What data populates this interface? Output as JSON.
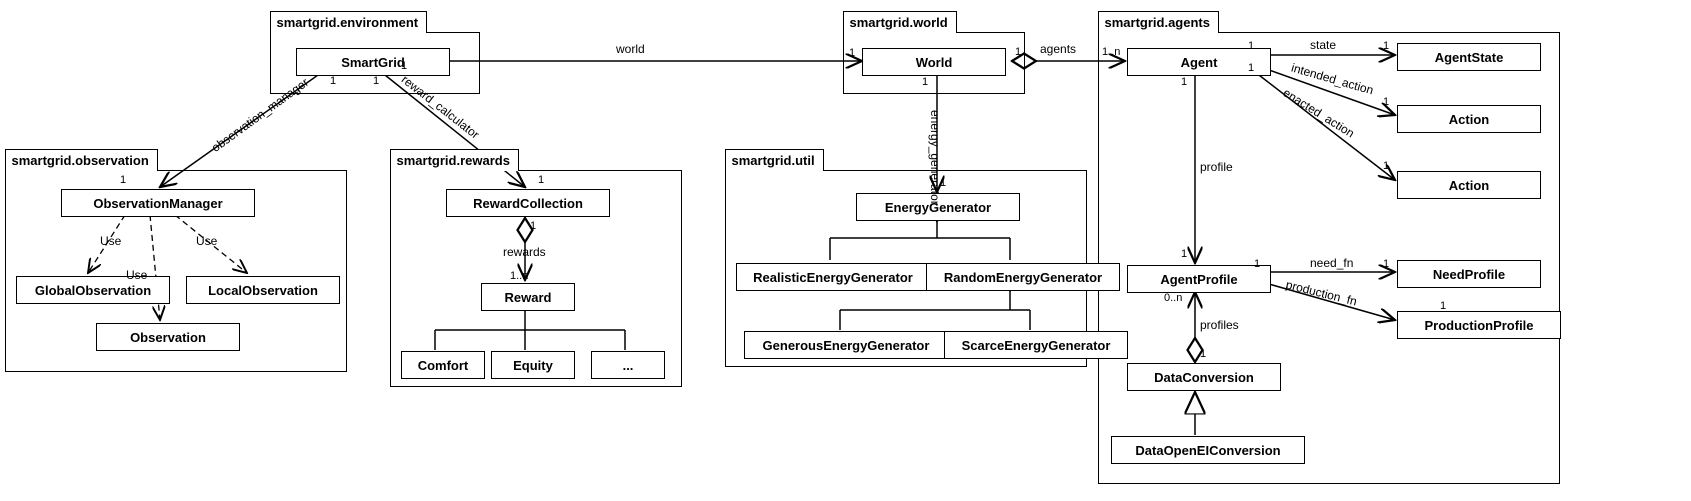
{
  "packages": {
    "environment": {
      "label": "smartgrid.environment"
    },
    "world": {
      "label": "smartgrid.world"
    },
    "agents": {
      "label": "smartgrid.agents"
    },
    "observation": {
      "label": "smartgrid.observation"
    },
    "rewards": {
      "label": "smartgrid.rewards"
    },
    "util": {
      "label": "smartgrid.util"
    }
  },
  "classes": {
    "SmartGrid": "SmartGrid",
    "World": "World",
    "Agent": "Agent",
    "AgentState": "AgentState",
    "Action1": "Action",
    "Action2": "Action",
    "AgentProfile": "AgentProfile",
    "NeedProfile": "NeedProfile",
    "ProductionProfile": "ProductionProfile",
    "DataConversion": "DataConversion",
    "DataOpenEIConversion": "DataOpenEIConversion",
    "ObservationManager": "ObservationManager",
    "GlobalObservation": "GlobalObservation",
    "LocalObservation": "LocalObservation",
    "Observation": "Observation",
    "RewardCollection": "RewardCollection",
    "Reward": "Reward",
    "Comfort": "Comfort",
    "Equity": "Equity",
    "Ellipsis": "...",
    "EnergyGenerator": "EnergyGenerator",
    "RealisticEnergyGenerator": "RealisticEnergyGenerator",
    "RandomEnergyGenerator": "RandomEnergyGenerator",
    "GenerousEnergyGenerator": "GenerousEnergyGenerator",
    "ScarceEnergyGenerator": "ScarceEnergyGenerator"
  },
  "labels": {
    "world_rel": "world",
    "agents_rel": "agents",
    "state_rel": "state",
    "intended_action": "intended_action",
    "enacted_action": "enacted_action",
    "profile": "profile",
    "need_fn": "need_fn",
    "production_fn": "production_fn",
    "profiles": "profiles",
    "energy_generator": "energy_generator",
    "observation_manager": "observation_manager",
    "reward_calculator": "reward_calculator",
    "Use": "Use",
    "rewards": "rewards"
  },
  "mults": {
    "one": "1",
    "one_n": "1..n",
    "zero_n": "0..n"
  },
  "chart_data": {
    "type": "uml_class_diagram",
    "packages": [
      {
        "name": "smartgrid.environment",
        "classes": [
          "SmartGrid"
        ]
      },
      {
        "name": "smartgrid.world",
        "classes": [
          "World"
        ]
      },
      {
        "name": "smartgrid.agents",
        "classes": [
          "Agent",
          "AgentState",
          "Action",
          "Action",
          "AgentProfile",
          "NeedProfile",
          "ProductionProfile",
          "DataConversion",
          "DataOpenEIConversion"
        ]
      },
      {
        "name": "smartgrid.observation",
        "classes": [
          "ObservationManager",
          "GlobalObservation",
          "LocalObservation",
          "Observation"
        ]
      },
      {
        "name": "smartgrid.rewards",
        "classes": [
          "RewardCollection",
          "Reward",
          "Comfort",
          "Equity",
          "..."
        ]
      },
      {
        "name": "smartgrid.util",
        "classes": [
          "EnergyGenerator",
          "RealisticEnergyGenerator",
          "RandomEnergyGenerator",
          "GenerousEnergyGenerator",
          "ScarceEnergyGenerator"
        ]
      }
    ],
    "relations": [
      {
        "from": "SmartGrid",
        "to": "World",
        "kind": "aggregation",
        "label": "world",
        "from_mult": "1",
        "to_mult": "1"
      },
      {
        "from": "World",
        "to": "Agent",
        "kind": "aggregation",
        "label": "agents",
        "from_mult": "1",
        "to_mult": "1..n"
      },
      {
        "from": "Agent",
        "to": "AgentState",
        "kind": "association",
        "label": "state",
        "from_mult": "1",
        "to_mult": "1"
      },
      {
        "from": "Agent",
        "to": "Action",
        "kind": "association",
        "label": "intended_action",
        "from_mult": "1",
        "to_mult": "1"
      },
      {
        "from": "Agent",
        "to": "Action",
        "kind": "association",
        "label": "enacted_action",
        "from_mult": "1",
        "to_mult": "1"
      },
      {
        "from": "Agent",
        "to": "AgentProfile",
        "kind": "association",
        "label": "profile",
        "from_mult": "1",
        "to_mult": "1"
      },
      {
        "from": "AgentProfile",
        "to": "NeedProfile",
        "kind": "association",
        "label": "need_fn",
        "from_mult": "1",
        "to_mult": "1"
      },
      {
        "from": "AgentProfile",
        "to": "ProductionProfile",
        "kind": "association",
        "label": "production_fn",
        "to_mult": "1"
      },
      {
        "from": "DataConversion",
        "to": "AgentProfile",
        "kind": "aggregation",
        "label": "profiles",
        "from_mult": "1",
        "to_mult": "0..n"
      },
      {
        "from": "DataOpenEIConversion",
        "to": "DataConversion",
        "kind": "generalization"
      },
      {
        "from": "World",
        "to": "EnergyGenerator",
        "kind": "association",
        "label": "energy_generator",
        "from_mult": "1",
        "to_mult": "1"
      },
      {
        "from": "SmartGrid",
        "to": "ObservationManager",
        "kind": "association",
        "label": "observation_manager",
        "from_mult": "1",
        "to_mult": "1"
      },
      {
        "from": "SmartGrid",
        "to": "RewardCollection",
        "kind": "association",
        "label": "reward_calculator",
        "from_mult": "1",
        "to_mult": "1"
      },
      {
        "from": "ObservationManager",
        "to": "GlobalObservation",
        "kind": "dependency",
        "label": "Use"
      },
      {
        "from": "ObservationManager",
        "to": "LocalObservation",
        "kind": "dependency",
        "label": "Use"
      },
      {
        "from": "ObservationManager",
        "to": "Observation",
        "kind": "dependency",
        "label": "Use"
      },
      {
        "from": "RewardCollection",
        "to": "Reward",
        "kind": "aggregation",
        "label": "rewards",
        "from_mult": "1",
        "to_mult": "1..n"
      },
      {
        "from": "Comfort",
        "to": "Reward",
        "kind": "generalization"
      },
      {
        "from": "Equity",
        "to": "Reward",
        "kind": "generalization"
      },
      {
        "from": "...",
        "to": "Reward",
        "kind": "generalization"
      },
      {
        "from": "RealisticEnergyGenerator",
        "to": "EnergyGenerator",
        "kind": "generalization"
      },
      {
        "from": "RandomEnergyGenerator",
        "to": "EnergyGenerator",
        "kind": "generalization"
      },
      {
        "from": "GenerousEnergyGenerator",
        "to": "RandomEnergyGenerator",
        "kind": "generalization"
      },
      {
        "from": "ScarceEnergyGenerator",
        "to": "RandomEnergyGenerator",
        "kind": "generalization"
      }
    ]
  }
}
